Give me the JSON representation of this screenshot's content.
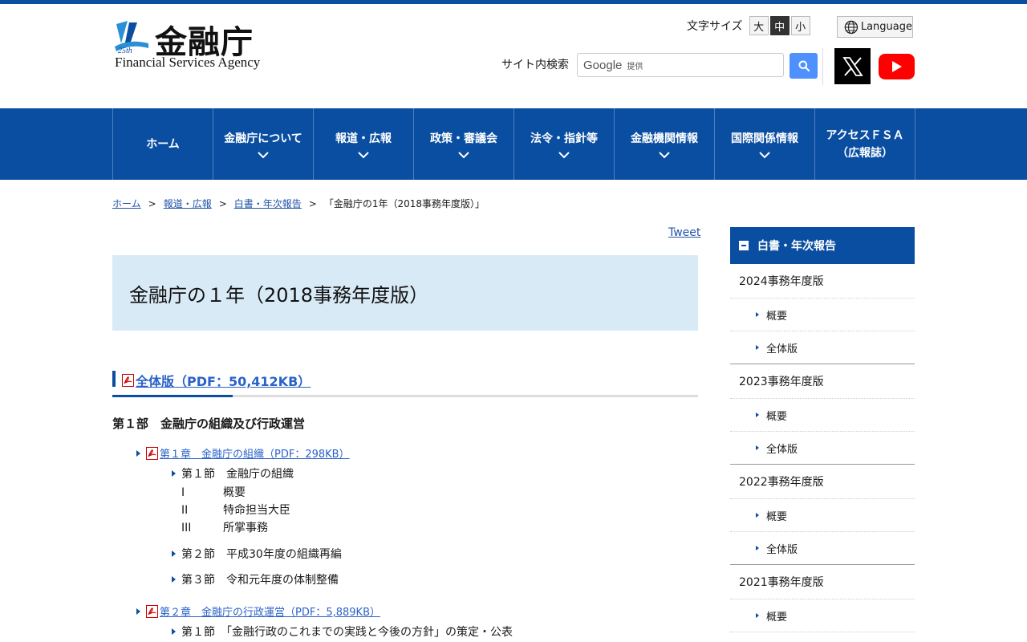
{
  "header": {
    "logo_jp": "金融庁",
    "logo_en": "Financial Services Agency",
    "logo_badge": "25th",
    "font_size_label": "文字サイズ",
    "font_sizes": [
      "大",
      "中",
      "小"
    ],
    "font_size_active": "中",
    "language_label": "Language",
    "search_label": "サイト内検索",
    "search_google": "Google",
    "search_provided": "提供"
  },
  "nav": {
    "items": [
      {
        "label": "ホーム",
        "has_dropdown": false
      },
      {
        "label": "金融庁について",
        "has_dropdown": true
      },
      {
        "label": "報道・広報",
        "has_dropdown": true
      },
      {
        "label": "政策・審議会",
        "has_dropdown": true
      },
      {
        "label": "法令・指針等",
        "has_dropdown": true
      },
      {
        "label": "金融機関情報",
        "has_dropdown": true
      },
      {
        "label": "国際関係情報",
        "has_dropdown": true
      },
      {
        "label": "アクセスＦＳＡ",
        "label2": "（広報誌）",
        "has_dropdown": false
      }
    ]
  },
  "breadcrumb": [
    "ホーム",
    "報道・広報",
    "白書・年次報告",
    "「金融庁の1年（2018事務年度版）」"
  ],
  "tweet": "Tweet",
  "title": "金融庁の１年（2018事務年度版）",
  "full_version": "全体版（PDF：50,412KB）",
  "part1": {
    "title": "第１部　金融庁の組織及び行政運営",
    "chapter1": {
      "label": "第１章　金融庁の組織（PDF：298KB）",
      "sec1": "第１節　金融庁の組織",
      "subs": [
        {
          "num": "I",
          "text": "概要"
        },
        {
          "num": "II",
          "text": "特命担当大臣"
        },
        {
          "num": "III",
          "text": "所掌事務"
        }
      ],
      "sec2": "第２節　平成30年度の組織再編",
      "sec3": "第３節　令和元年度の体制整備"
    },
    "chapter2": {
      "label": "第２章　金融庁の行政運営（PDF：5,889KB）",
      "sec1": "第１節　「金融行政のこれまでの実践と今後の方針」の策定・公表"
    }
  },
  "sidebar": {
    "heading": "白書・年次報告",
    "years": [
      {
        "label": "2024事務年度版",
        "items": [
          "概要",
          "全体版"
        ]
      },
      {
        "label": "2023事務年度版",
        "items": [
          "概要",
          "全体版"
        ]
      },
      {
        "label": "2022事務年度版",
        "items": [
          "概要",
          "全体版"
        ]
      },
      {
        "label": "2021事務年度版",
        "items": [
          "概要"
        ]
      }
    ]
  },
  "colors": {
    "brand_blue": "#0a4ea2",
    "title_bg": "#d9eaf7",
    "link": "#2a62c9"
  }
}
